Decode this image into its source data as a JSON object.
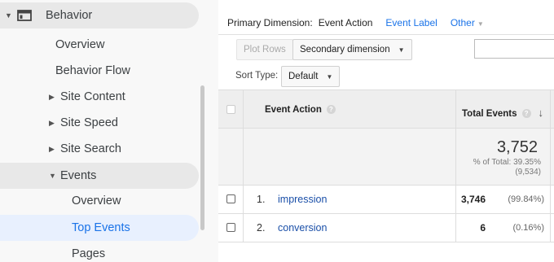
{
  "sidebar": {
    "section": {
      "label": "Behavior",
      "icon": "behavior-window-icon"
    },
    "items": [
      {
        "label": "Overview"
      },
      {
        "label": "Behavior Flow"
      },
      {
        "label": "Site Content"
      },
      {
        "label": "Site Speed"
      },
      {
        "label": "Site Search"
      },
      {
        "label": "Events"
      },
      {
        "label": "Overview"
      },
      {
        "label": "Top Events"
      },
      {
        "label": "Pages"
      }
    ]
  },
  "dimension_bar": {
    "label": "Primary Dimension:",
    "current": "Event Action",
    "option_event_label": "Event Label",
    "option_other": "Other"
  },
  "toolbar": {
    "plot_rows": "Plot Rows",
    "secondary_dimension": "Secondary dimension",
    "sort_type_label": "Sort Type:",
    "sort_type_value": "Default"
  },
  "table": {
    "col_event_action": "Event Action",
    "col_total_events": "Total Events",
    "summary": {
      "total": "3,752",
      "pct_of_total": "% of Total: 39.35%",
      "overall": "(9,534)"
    },
    "rows": [
      {
        "index": "1.",
        "name": "impression",
        "value": "3,746",
        "pct": "(99.84%)"
      },
      {
        "index": "2.",
        "name": "conversion",
        "value": "6",
        "pct": "(0.16%)"
      }
    ]
  },
  "colors": {
    "accent": "#1a73e8",
    "link": "#1a4fa8",
    "selected_bg": "#e8f0fe"
  }
}
